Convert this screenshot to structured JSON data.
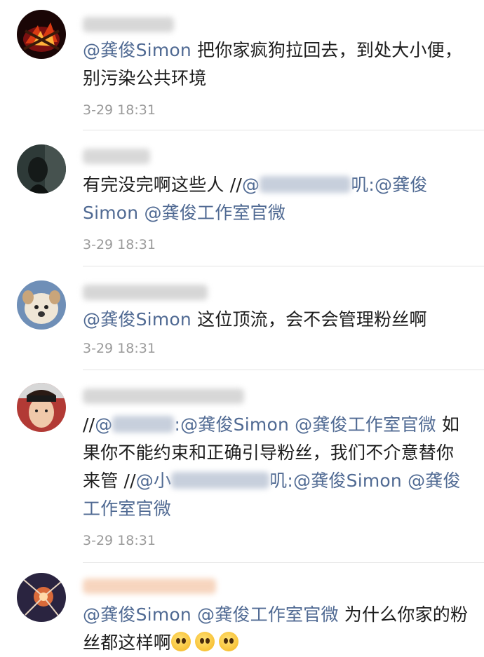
{
  "comments": [
    {
      "name_hidden": true,
      "segments": [
        {
          "t": "@龚俊Simon",
          "m": true
        },
        {
          "t": " 把你家疯狗拉回去，到处大小便，别污染公共环境",
          "m": false
        }
      ],
      "time": "3-29 18:31"
    },
    {
      "name_hidden": true,
      "segments": [
        {
          "t": "有完没完啊这些人 //",
          "m": false
        },
        {
          "t": "@",
          "m": true
        },
        {
          "blur": true
        },
        {
          "t": "叽:@龚俊Simon @龚俊工作室官微",
          "m": true
        }
      ],
      "time": "3-29 18:31"
    },
    {
      "name_hidden": true,
      "segments": [
        {
          "t": "@龚俊Simon",
          "m": true
        },
        {
          "t": " 这位顶流，会不会管理粉丝啊",
          "m": false
        }
      ],
      "time": "3-29 18:31"
    },
    {
      "name_hidden": true,
      "segments": [
        {
          "t": "//",
          "m": false
        },
        {
          "t": "@",
          "m": true
        },
        {
          "blur": true
        },
        {
          "t": ":@龚俊Simon @龚俊工作室官微",
          "m": true
        },
        {
          "t": " 如果你不能约束和正确引导粉丝，我们不介意替你来管 //",
          "m": false
        },
        {
          "t": "@小",
          "m": true
        },
        {
          "blur": true
        },
        {
          "t": "叽:@龚俊Simon @龚俊工作室官微",
          "m": true
        }
      ],
      "time": "3-29 18:31"
    },
    {
      "name_hidden": true,
      "segments": [
        {
          "t": "@龚俊Simon @龚俊工作室官微",
          "m": true
        },
        {
          "t": " 为什么你家的粉丝都这样啊",
          "m": false
        },
        {
          "emoji": "pleading-face"
        },
        {
          "emoji": "pleading-face"
        },
        {
          "emoji": "pleading-face"
        }
      ],
      "time": ""
    }
  ]
}
